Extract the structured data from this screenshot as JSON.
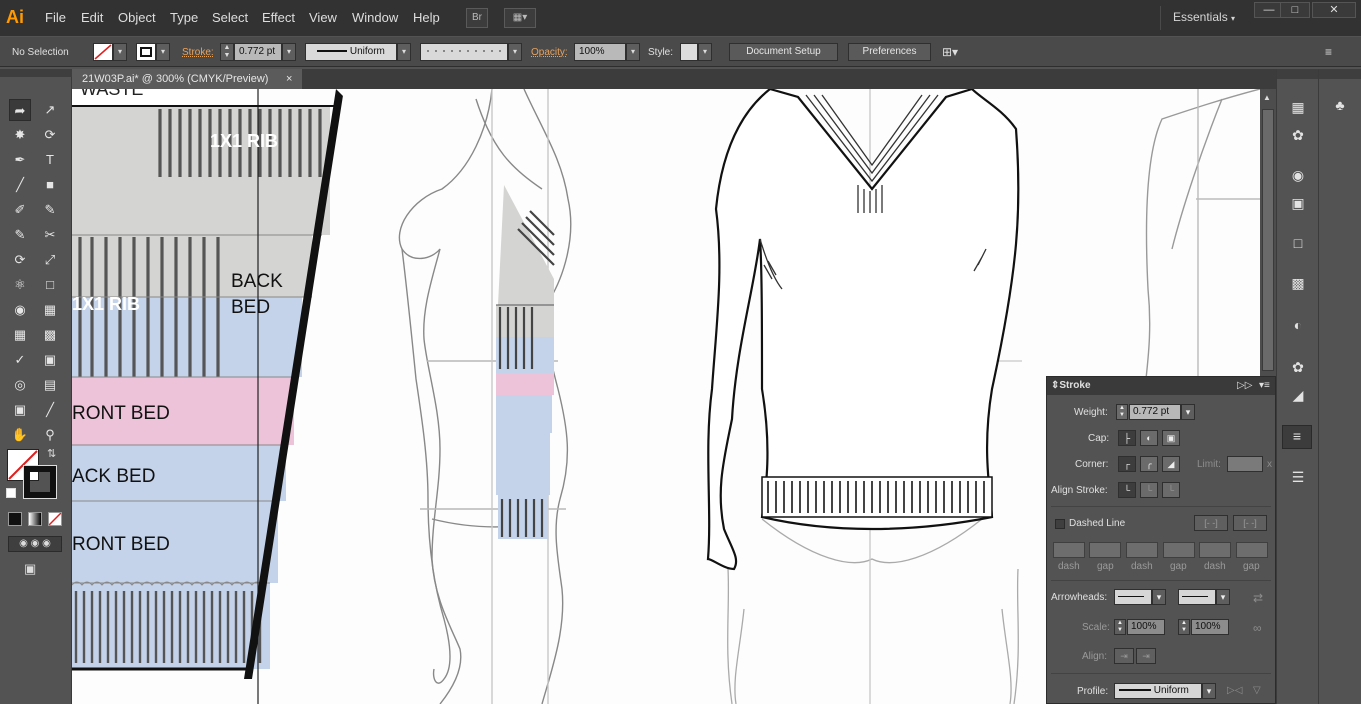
{
  "app": {
    "logo": "Ai"
  },
  "menu": [
    "File",
    "Edit",
    "Object",
    "Type",
    "Select",
    "Effect",
    "View",
    "Window",
    "Help"
  ],
  "menubar": {
    "bridge_label": "Br",
    "workspace": "Essentials",
    "win_min": "—",
    "win_max": "□",
    "win_close": "✕"
  },
  "control": {
    "selection": "No Selection",
    "stroke_label": "Stroke:",
    "stroke_value": "0.772 pt",
    "profile_label": "Uniform",
    "opacity_label": "Opacity:",
    "opacity_value": "100%",
    "style_label": "Style:",
    "document_setup": "Document Setup",
    "preferences": "Preferences"
  },
  "document_tab": {
    "title": "21W03P.ai* @ 300% (CMYK/Preview)",
    "close": "×"
  },
  "canvas_labels": {
    "waste": "WASTE",
    "rib_top": "1X1 RIB",
    "back_bed_1": "BACK",
    "back_bed_2": "BED",
    "rib_mid": "1X1 RIB",
    "front_bed_1": "RONT BED",
    "back_bed_row": "ACK BED",
    "front_bed_2": "RONT BED"
  },
  "stroke_panel": {
    "title": "Stroke",
    "weight_label": "Weight:",
    "weight_value": "0.772 pt",
    "cap_label": "Cap:",
    "corner_label": "Corner:",
    "limit_label": "Limit:",
    "limit_unit": "x",
    "align_label": "Align Stroke:",
    "dashed_label": "Dashed Line",
    "dash_labels": [
      "dash",
      "gap",
      "dash",
      "gap",
      "dash",
      "gap"
    ],
    "arrowheads_label": "Arrowheads:",
    "scale_label": "Scale:",
    "scale_start": "100%",
    "scale_end": "100%",
    "align_arrow_label": "Align:",
    "profile_label": "Profile:",
    "profile_value": "Uniform"
  },
  "colors": {
    "rib_grey": "#d4d4d2",
    "back_bed_blue": "#c4d3ea",
    "front_bed_pink": "#ecc3d8",
    "accent_orange": "#ff9a00"
  }
}
